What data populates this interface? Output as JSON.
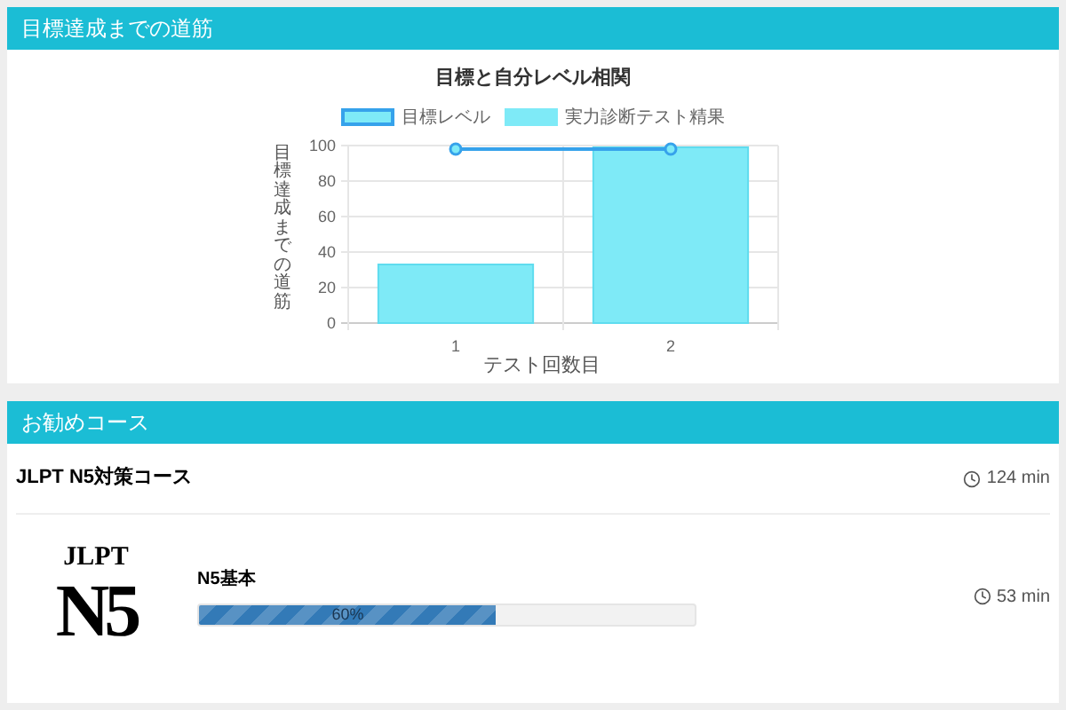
{
  "progress_section": {
    "title": "目標達成までの道筋",
    "chart_data": {
      "type": "bar",
      "title": "目標と自分レベル相関",
      "xlabel": "テスト回数目",
      "ylabel": "目標達成までの道筋",
      "categories": [
        "1",
        "2"
      ],
      "ylim": [
        0,
        100
      ],
      "grid": true,
      "yticks": [
        0,
        20,
        40,
        60,
        80,
        100
      ],
      "series": [
        {
          "name": "目標レベル",
          "type": "line",
          "marker": true,
          "color": "#36a2eb",
          "values": [
            98,
            98
          ]
        },
        {
          "name": "実力診断テスト精果",
          "type": "bar",
          "color": "#7eeaf7",
          "values": [
            33,
            99
          ]
        }
      ]
    }
  },
  "courses_section": {
    "title": "お勧めコース",
    "course": {
      "name": "JLPT N5対策コース",
      "duration": "124 min"
    },
    "lessons": [
      {
        "logo_top": "JLPT",
        "logo_main": "N5",
        "name": "N5基本",
        "level": 0.6,
        "progress_label": "60%",
        "duration": "53 min"
      }
    ]
  }
}
